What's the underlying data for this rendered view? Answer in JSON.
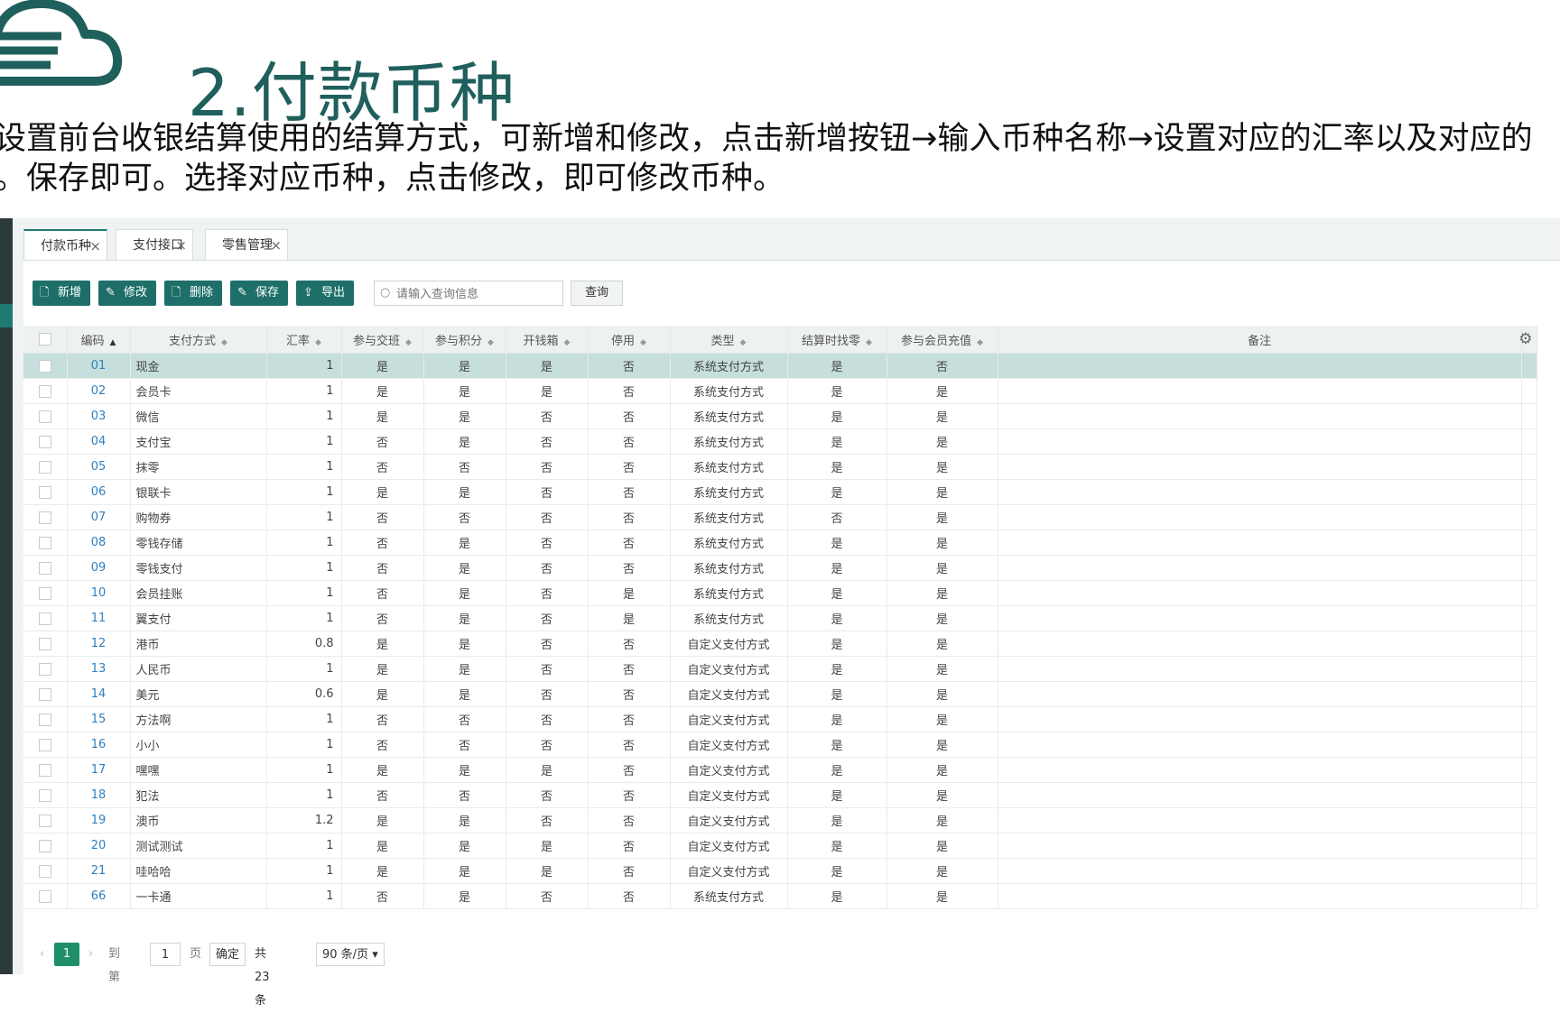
{
  "slide": {
    "title": "2.付款币种",
    "desc_line1": "设置前台收银结算使用的结算方式，可新增和修改，点击新增按钮→输入币种名称→设置对应的汇率以及对应的",
    "desc_line2": "。保存即可。选择对应币种，点击修改，即可修改币种。"
  },
  "tabs": [
    {
      "label": "付款币种",
      "icon": "close-icon"
    },
    {
      "label": "支付接口",
      "icon": "close-icon"
    },
    {
      "label": "零售管理",
      "icon": "close-icon"
    }
  ],
  "toolbar": {
    "add": "新增",
    "edit": "修改",
    "delete": "删除",
    "save": "保存",
    "export": "导出",
    "search_placeholder": "请输入查询信息",
    "query": "查询"
  },
  "columns": [
    "编码",
    "支付方式",
    "汇率",
    "参与交班",
    "参与积分",
    "开钱箱",
    "停用",
    "类型",
    "结算时找零",
    "参与会员充值",
    "备注"
  ],
  "rows": [
    {
      "code": "01",
      "name": "现金",
      "rate": "1",
      "shift": "是",
      "points": "是",
      "drawer": "是",
      "disabled": "否",
      "type": "系统支付方式",
      "change": "是",
      "recharge": "否",
      "remark": ""
    },
    {
      "code": "02",
      "name": "会员卡",
      "rate": "1",
      "shift": "是",
      "points": "是",
      "drawer": "是",
      "disabled": "否",
      "type": "系统支付方式",
      "change": "是",
      "recharge": "是",
      "remark": ""
    },
    {
      "code": "03",
      "name": "微信",
      "rate": "1",
      "shift": "是",
      "points": "是",
      "drawer": "否",
      "disabled": "否",
      "type": "系统支付方式",
      "change": "是",
      "recharge": "是",
      "remark": ""
    },
    {
      "code": "04",
      "name": "支付宝",
      "rate": "1",
      "shift": "否",
      "points": "是",
      "drawer": "否",
      "disabled": "否",
      "type": "系统支付方式",
      "change": "是",
      "recharge": "是",
      "remark": ""
    },
    {
      "code": "05",
      "name": "抹零",
      "rate": "1",
      "shift": "否",
      "points": "否",
      "drawer": "否",
      "disabled": "否",
      "type": "系统支付方式",
      "change": "是",
      "recharge": "是",
      "remark": ""
    },
    {
      "code": "06",
      "name": "银联卡",
      "rate": "1",
      "shift": "是",
      "points": "是",
      "drawer": "否",
      "disabled": "否",
      "type": "系统支付方式",
      "change": "是",
      "recharge": "是",
      "remark": ""
    },
    {
      "code": "07",
      "name": "购物券",
      "rate": "1",
      "shift": "否",
      "points": "否",
      "drawer": "否",
      "disabled": "否",
      "type": "系统支付方式",
      "change": "否",
      "recharge": "是",
      "remark": ""
    },
    {
      "code": "08",
      "name": "零钱存储",
      "rate": "1",
      "shift": "否",
      "points": "是",
      "drawer": "否",
      "disabled": "否",
      "type": "系统支付方式",
      "change": "是",
      "recharge": "是",
      "remark": ""
    },
    {
      "code": "09",
      "name": "零钱支付",
      "rate": "1",
      "shift": "否",
      "points": "是",
      "drawer": "否",
      "disabled": "否",
      "type": "系统支付方式",
      "change": "是",
      "recharge": "是",
      "remark": ""
    },
    {
      "code": "10",
      "name": "会员挂账",
      "rate": "1",
      "shift": "否",
      "points": "是",
      "drawer": "否",
      "disabled": "是",
      "type": "系统支付方式",
      "change": "是",
      "recharge": "是",
      "remark": ""
    },
    {
      "code": "11",
      "name": "翼支付",
      "rate": "1",
      "shift": "否",
      "points": "是",
      "drawer": "否",
      "disabled": "是",
      "type": "系统支付方式",
      "change": "是",
      "recharge": "是",
      "remark": ""
    },
    {
      "code": "12",
      "name": "港币",
      "rate": "0.8",
      "shift": "是",
      "points": "是",
      "drawer": "否",
      "disabled": "否",
      "type": "自定义支付方式",
      "change": "是",
      "recharge": "是",
      "remark": ""
    },
    {
      "code": "13",
      "name": "人民币",
      "rate": "1",
      "shift": "是",
      "points": "是",
      "drawer": "否",
      "disabled": "否",
      "type": "自定义支付方式",
      "change": "是",
      "recharge": "是",
      "remark": ""
    },
    {
      "code": "14",
      "name": "美元",
      "rate": "0.6",
      "shift": "是",
      "points": "是",
      "drawer": "否",
      "disabled": "否",
      "type": "自定义支付方式",
      "change": "是",
      "recharge": "是",
      "remark": ""
    },
    {
      "code": "15",
      "name": "方法啊",
      "rate": "1",
      "shift": "否",
      "points": "否",
      "drawer": "否",
      "disabled": "否",
      "type": "自定义支付方式",
      "change": "是",
      "recharge": "是",
      "remark": ""
    },
    {
      "code": "16",
      "name": "小小",
      "rate": "1",
      "shift": "否",
      "points": "否",
      "drawer": "否",
      "disabled": "否",
      "type": "自定义支付方式",
      "change": "是",
      "recharge": "是",
      "remark": ""
    },
    {
      "code": "17",
      "name": "嘿嘿",
      "rate": "1",
      "shift": "是",
      "points": "是",
      "drawer": "是",
      "disabled": "否",
      "type": "自定义支付方式",
      "change": "是",
      "recharge": "是",
      "remark": ""
    },
    {
      "code": "18",
      "name": "犯法",
      "rate": "1",
      "shift": "否",
      "points": "否",
      "drawer": "否",
      "disabled": "否",
      "type": "自定义支付方式",
      "change": "是",
      "recharge": "是",
      "remark": ""
    },
    {
      "code": "19",
      "name": "澳币",
      "rate": "1.2",
      "shift": "是",
      "points": "是",
      "drawer": "否",
      "disabled": "否",
      "type": "自定义支付方式",
      "change": "是",
      "recharge": "是",
      "remark": ""
    },
    {
      "code": "20",
      "name": "测试测试",
      "rate": "1",
      "shift": "是",
      "points": "是",
      "drawer": "是",
      "disabled": "否",
      "type": "自定义支付方式",
      "change": "是",
      "recharge": "是",
      "remark": ""
    },
    {
      "code": "21",
      "name": "哇哈哈",
      "rate": "1",
      "shift": "是",
      "points": "是",
      "drawer": "是",
      "disabled": "否",
      "type": "自定义支付方式",
      "change": "是",
      "recharge": "是",
      "remark": ""
    },
    {
      "code": "66",
      "name": "一卡通",
      "rate": "1",
      "shift": "否",
      "points": "是",
      "drawer": "否",
      "disabled": "否",
      "type": "系统支付方式",
      "change": "是",
      "recharge": "是",
      "remark": ""
    }
  ],
  "selected_row": 0,
  "pager": {
    "current": "1",
    "goto_label": "到第",
    "goto_value": "1",
    "page_label": "页",
    "confirm": "确定",
    "total": "共 23 条",
    "page_size": "90 条/页"
  },
  "colors": {
    "accent": "#1e6f6a",
    "title": "#1f5f5c",
    "selected_row": "#c6dedc",
    "code_link": "#2f7fbf"
  }
}
